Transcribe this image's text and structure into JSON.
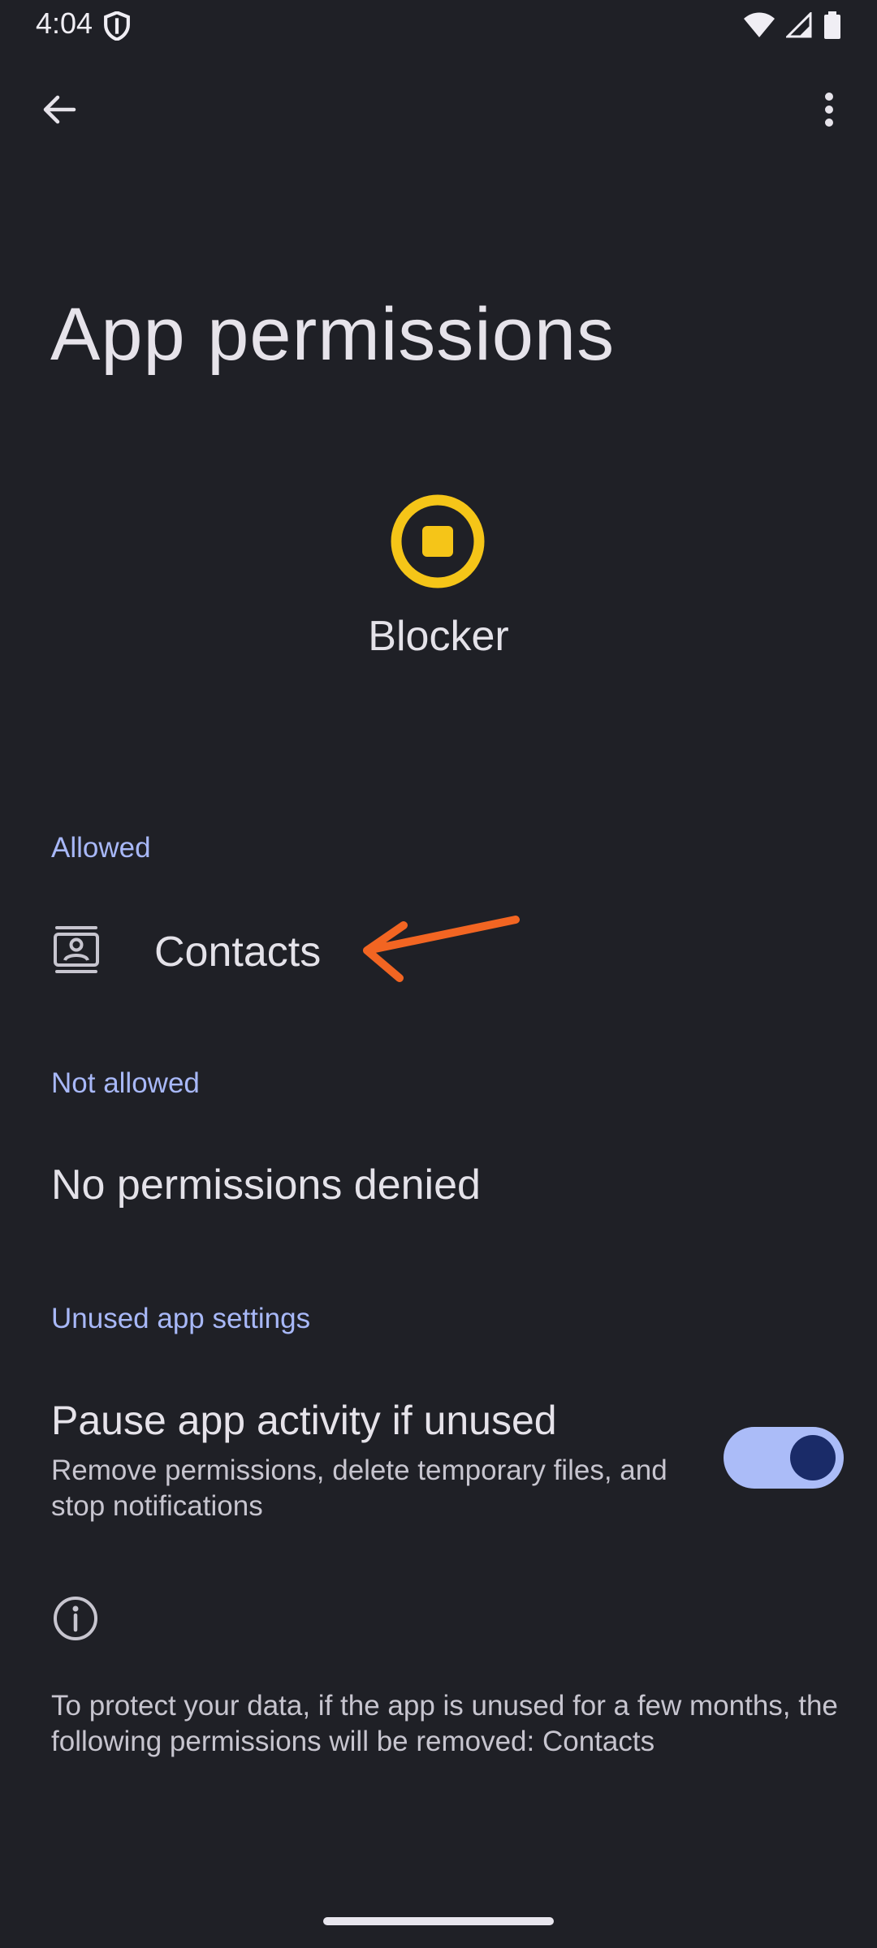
{
  "status_bar": {
    "time": "4:04",
    "icons": [
      "shield-icon",
      "wifi-icon",
      "signal-icon",
      "battery-icon"
    ]
  },
  "toolbar": {
    "back_icon": "arrow-back-icon",
    "more_icon": "more-vert-icon"
  },
  "page": {
    "title": "App permissions"
  },
  "app": {
    "name": "Blocker",
    "icon_color": "#f5c518"
  },
  "sections": {
    "allowed": {
      "header": "Allowed",
      "items": [
        {
          "label": "Contacts",
          "icon": "contacts-icon"
        }
      ]
    },
    "not_allowed": {
      "header": "Not allowed",
      "empty_text": "No permissions denied"
    },
    "unused": {
      "header": "Unused app settings",
      "pause_title": "Pause app activity if unused",
      "pause_subtitle": "Remove permissions, delete temporary files, and stop notifications",
      "pause_enabled": true
    }
  },
  "info": {
    "icon": "info-icon",
    "text": "To protect your data, if the app is unused for a few months, the following permissions will be removed: Contacts"
  },
  "colors": {
    "background": "#1f2026",
    "accent": "#a8b8f8",
    "annotation_arrow": "#f26522"
  }
}
